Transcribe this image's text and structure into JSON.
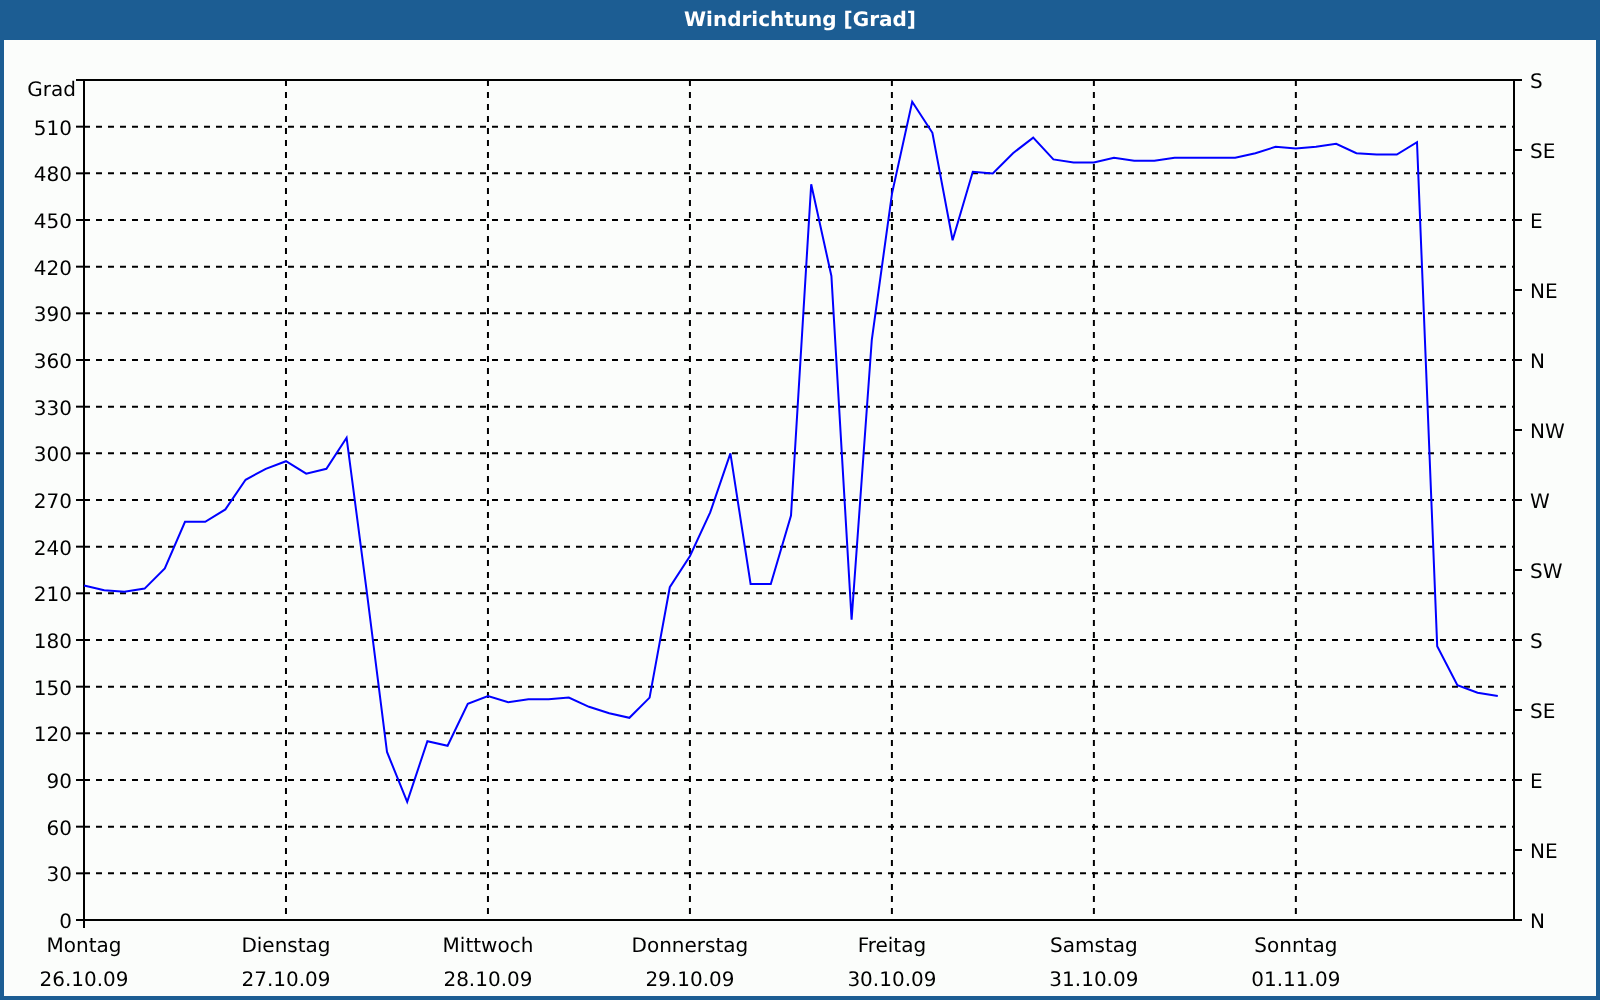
{
  "window": {
    "title": "Windrichtung [Grad]"
  },
  "chart": {
    "chart_data": {
      "type": "line",
      "ylabel": "Grad",
      "ylim": [
        0,
        540
      ],
      "grid": true,
      "categories": [
        "Montag\n26.10.09",
        null,
        null,
        null,
        null,
        null,
        null,
        null,
        null,
        null,
        "Dienstag\n27.10.09",
        null,
        null,
        null,
        null,
        null,
        null,
        null,
        null,
        null,
        "Mittwoch\n28.10.09",
        null,
        null,
        null,
        null,
        null,
        null,
        null,
        null,
        null,
        "Donnerstag\n29.10.09",
        null,
        null,
        null,
        null,
        null,
        null,
        null,
        null,
        null,
        "Freitag\n30.10.09",
        null,
        null,
        null,
        null,
        null,
        null,
        null,
        null,
        null,
        "Samstag\n31.10.09",
        null,
        null,
        null,
        null,
        null,
        null,
        null,
        null,
        null,
        "Sonntag\n01.11.09",
        null,
        null,
        null,
        null,
        null,
        null,
        null,
        null,
        null,
        null
      ],
      "series": [
        {
          "color": "#0000ff",
          "values": [
            215,
            212,
            211,
            213,
            226,
            256,
            256,
            264,
            283,
            290,
            295,
            287,
            290,
            310,
            211,
            108,
            76,
            115,
            112,
            139,
            144,
            140,
            142,
            142,
            143,
            137,
            133,
            130,
            143,
            214,
            234,
            262,
            300,
            216,
            216,
            260,
            473,
            414,
            193,
            373,
            467,
            526,
            506,
            437,
            481,
            480,
            493,
            503,
            489,
            487,
            487,
            490,
            488,
            488,
            490,
            490,
            490,
            490,
            493,
            497,
            496,
            497,
            499,
            493,
            492,
            492,
            500,
            176,
            151,
            146,
            144
          ]
        }
      ],
      "yticks": [
        0,
        30,
        60,
        90,
        120,
        150,
        180,
        210,
        240,
        270,
        300,
        330,
        360,
        390,
        420,
        450,
        480,
        510
      ]
    },
    "compass_labels": [
      "S",
      "SE",
      "E",
      "NE",
      "N",
      "NW",
      "W",
      "SW",
      "S",
      "SE",
      "E",
      "NE",
      "N"
    ]
  }
}
